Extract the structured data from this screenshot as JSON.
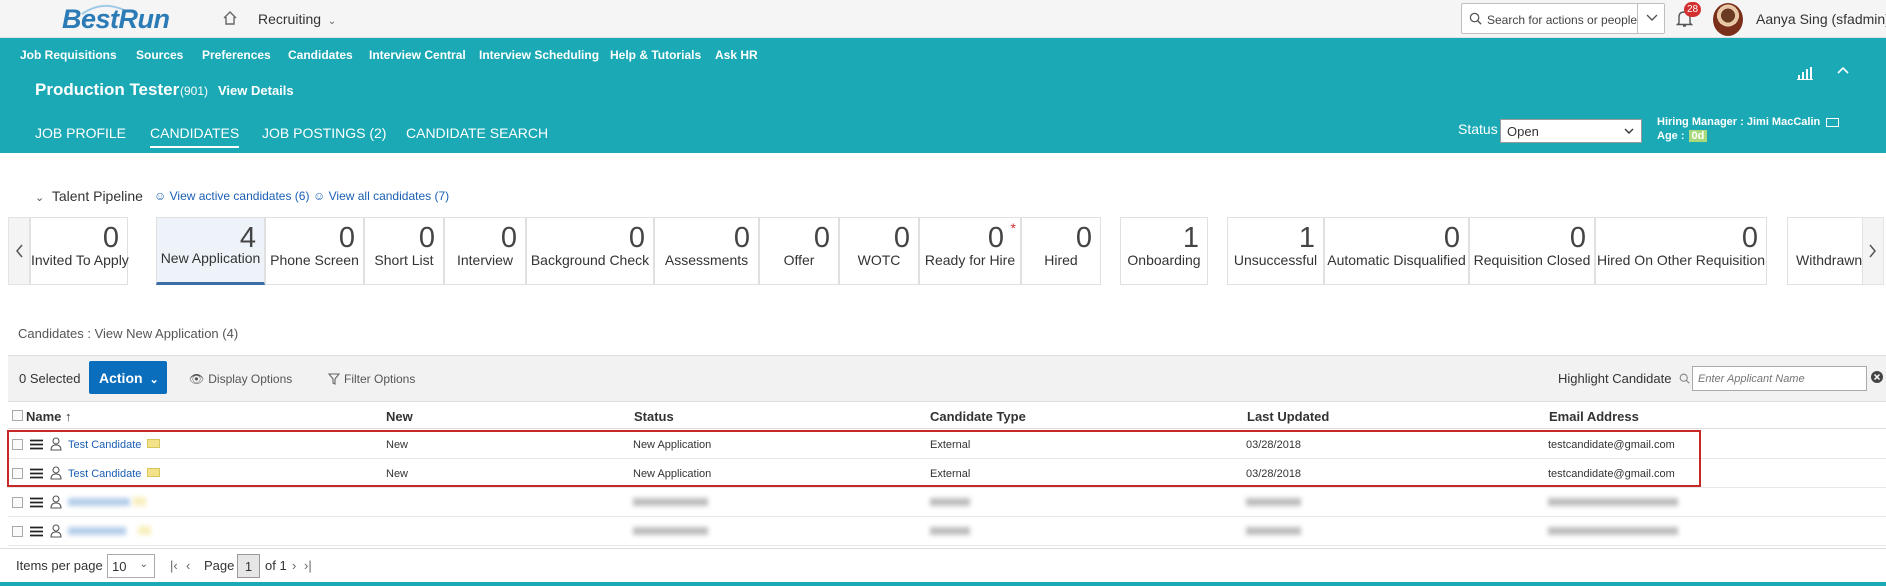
{
  "header": {
    "logo": "BestRun",
    "module": "Recruiting",
    "search_placeholder": "Search for actions or people",
    "notification_count": "28",
    "user_name": "Aanya Sing (sfadmin)"
  },
  "nav": [
    "Job Requisitions",
    "Sources",
    "Preferences",
    "Candidates",
    "Interview Central",
    "Interview Scheduling",
    "Help & Tutorials",
    "Ask HR"
  ],
  "requisition": {
    "title": "Production Tester",
    "id": "(901)",
    "view_details": "View Details"
  },
  "tabs": [
    "JOB PROFILE",
    "CANDIDATES",
    "JOB POSTINGS (2)",
    "CANDIDATE SEARCH"
  ],
  "status": {
    "label": "Status",
    "value": "Open"
  },
  "hiring_manager": {
    "label": "Hiring Manager :",
    "name": "Jimi MacCalin"
  },
  "age": {
    "label": "Age :",
    "value": "0d"
  },
  "pipeline": {
    "title": "Talent Pipeline",
    "active_link": "View active candidates (6)",
    "all_link": "View all candidates (7)",
    "stages": [
      {
        "count": "0",
        "label": "Invited To Apply"
      },
      {
        "count": "4",
        "label": "New Application"
      },
      {
        "count": "0",
        "label": "Phone Screen"
      },
      {
        "count": "0",
        "label": "Short List"
      },
      {
        "count": "0",
        "label": "Interview"
      },
      {
        "count": "0",
        "label": "Background Check"
      },
      {
        "count": "0",
        "label": "Assessments"
      },
      {
        "count": "0",
        "label": "Offer"
      },
      {
        "count": "0",
        "label": "WOTC"
      },
      {
        "count": "0",
        "label": "Ready for Hire"
      },
      {
        "count": "0",
        "label": "Hired"
      },
      {
        "count": "1",
        "label": "Onboarding"
      },
      {
        "count": "1",
        "label": "Unsuccessful"
      },
      {
        "count": "0",
        "label": "Automatic Disqualified"
      },
      {
        "count": "0",
        "label": "Requisition Closed"
      },
      {
        "count": "0",
        "label": "Hired On Other Requisition"
      },
      {
        "count": "",
        "label": "Withdrawn"
      }
    ]
  },
  "breadcrumb": "Candidates : View New Application (4)",
  "toolbar": {
    "selected": "0 Selected",
    "action": "Action",
    "display_options": "Display Options",
    "filter_options": "Filter Options",
    "highlight_label": "Highlight Candidate",
    "highlight_placeholder": "Enter Applicant Name"
  },
  "table": {
    "columns": [
      "Name",
      "New",
      "Status",
      "Candidate Type",
      "Last Updated",
      "Email Address"
    ],
    "rows": [
      {
        "name": "Test Candidate",
        "new": "New",
        "status": "New Application",
        "type": "External",
        "updated": "03/28/2018",
        "email": "testcandidate@gmail.com"
      },
      {
        "name": "Test Candidate",
        "new": "New",
        "status": "New Application",
        "type": "External",
        "updated": "03/28/2018",
        "email": "testcandidate@gmail.com"
      }
    ]
  },
  "footer": {
    "items_per_page": "Items per page",
    "per_page_value": "10",
    "page_label": "Page",
    "page_value": "1",
    "of_label": "of 1"
  }
}
